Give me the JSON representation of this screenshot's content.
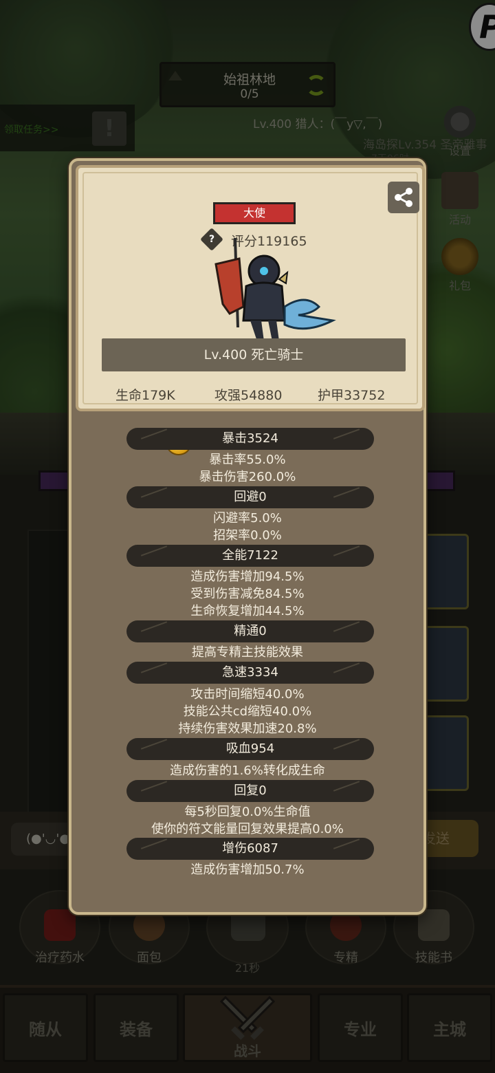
{
  "stage": {
    "name": "始祖林地",
    "progress": "0/5"
  },
  "quest": {
    "text": "领取任务>>",
    "icon_symbol": "!"
  },
  "player_line": "Lv.400 猎人：(￣y▽,￣)",
  "ticker": "海岛探Lv.354 圣帝雅事",
  "ticker_time": "7天06时",
  "brand_logo": "P",
  "side_menu": {
    "settings": "设置",
    "activity": "活动",
    "gift": "礼包"
  },
  "chat": {
    "input_value": "(●'◡'●",
    "send_label": "发送"
  },
  "quick_items": [
    {
      "label": "治疗药水"
    },
    {
      "label": "面包"
    },
    {
      "label": "专精"
    },
    {
      "label": "技能书"
    }
  ],
  "chest_timer": "21秒",
  "nav": {
    "follower": "随从",
    "equipment": "装备",
    "battle": "战斗",
    "profession": "专业",
    "city": "主城"
  },
  "hero": {
    "title": "大使",
    "score": "评分119165",
    "help_symbol": "?",
    "name": "Lv.400 死亡骑士",
    "hp": "生命179K",
    "attack": "攻强54880",
    "armor": "护甲33752"
  },
  "attributes": [
    {
      "header": "暴击3524",
      "lines": [
        "暴击率55.0%",
        "暴击伤害260.0%"
      ]
    },
    {
      "header": "回避0",
      "lines": [
        "闪避率5.0%",
        "招架率0.0%"
      ]
    },
    {
      "header": "全能7122",
      "lines": [
        "造成伤害增加94.5%",
        "受到伤害减免84.5%",
        "生命恢复增加44.5%"
      ]
    },
    {
      "header": "精通0",
      "lines": [
        "提高专精主技能效果"
      ]
    },
    {
      "header": "急速3334",
      "lines": [
        "攻击时间缩短40.0%",
        "技能公共cd缩短40.0%",
        "持续伤害效果加速20.8%"
      ]
    },
    {
      "header": "吸血954",
      "lines": [
        "造成伤害的1.6%转化成生命"
      ]
    },
    {
      "header": "回复0",
      "lines": [
        "每5秒回复0.0%生命值",
        "使你的符文能量回复效果提高0.0%"
      ]
    },
    {
      "header": "增伤6087",
      "lines": [
        "造成伤害增加50.7%"
      ]
    }
  ],
  "colors": {
    "title_badge": "#c43230",
    "dialog_bg": "#7b6c58",
    "card_bg": "#e8dcbf",
    "header_pill": "#2c2823"
  }
}
